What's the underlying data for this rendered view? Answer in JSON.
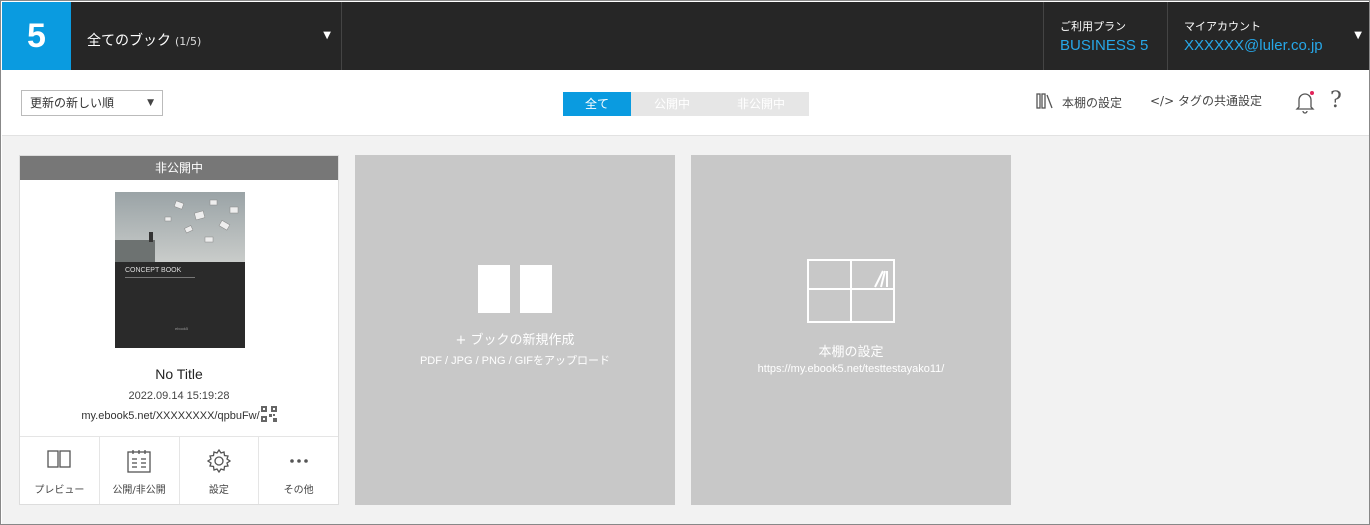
{
  "header": {
    "logo": "5",
    "book_selector": {
      "title": "全てのブック",
      "count": "(1/5)"
    },
    "plan": {
      "label": "ご利用プラン",
      "value": "BUSINESS 5"
    },
    "account": {
      "label": "マイアカウント",
      "value": "XXXXXX@luler.co.jp"
    }
  },
  "toolbar": {
    "sort": "更新の新しい順",
    "tabs": [
      {
        "label": "全て",
        "active": true
      },
      {
        "label": "公開中",
        "active": false
      },
      {
        "label": "非公開中",
        "active": false
      }
    ],
    "bookshelf_settings": "本棚の設定",
    "tag_settings": "</> タグの共通設定"
  },
  "book": {
    "status": "非公開中",
    "cover_text": "CONCEPT BOOK",
    "cover_brand": "ebook5",
    "title": "No Title",
    "updated": "2022.09.14 15:19:28",
    "url": "my.ebook5.net/XXXXXXXX/qpbuFw/",
    "actions": [
      "プレビュー",
      "公開/非公開",
      "設定",
      "その他"
    ]
  },
  "new_book_tile": {
    "title": "+ ブックの新規作成",
    "subtitle": "PDF / JPG / PNG / GIFをアップロード"
  },
  "shelf_tile": {
    "title": "本棚の設定",
    "subtitle": "https://my.ebook5.net/testtestayako11/"
  },
  "colors": {
    "accent": "#0a9be0",
    "topbar": "#262626",
    "tile": "#c8c8c8",
    "status_bar": "#777777"
  }
}
